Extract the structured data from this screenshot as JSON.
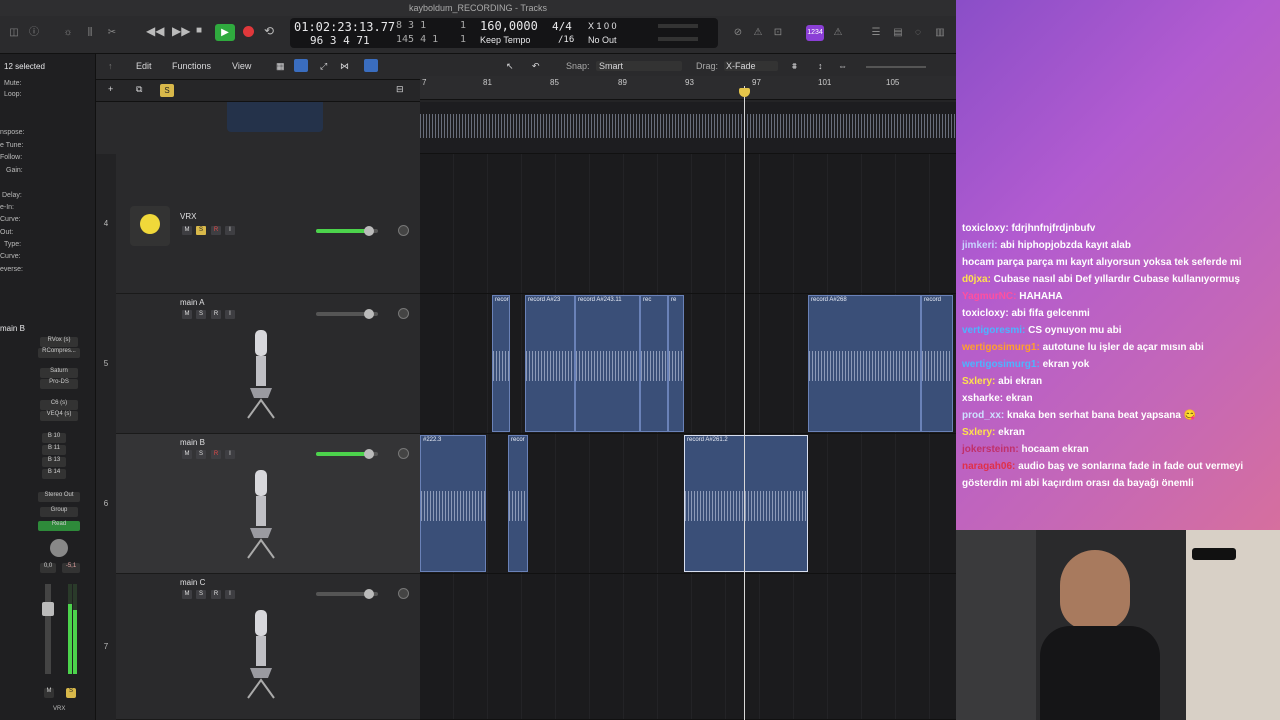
{
  "window": {
    "title": "kayboldum_RECORDING - Tracks"
  },
  "lcd": {
    "time": "01:02:23:13.77",
    "bars": "96 3 4 71",
    "bar_pos_a": "8 3 1",
    "bar_pos_b": "145 4 1",
    "pos_one": "1",
    "tempo": "160,0000",
    "tempo_mode": "Keep Tempo",
    "signature": "4/4",
    "division": "/16",
    "in_label": "X 1 0 0",
    "out_label": "No Out"
  },
  "edit_menu": {
    "edit": "Edit",
    "functions": "Functions",
    "view": "View",
    "snap_label": "Snap:",
    "snap_value": "Smart",
    "drag_label": "Drag:",
    "drag_value": "X-Fade"
  },
  "inspector": {
    "selected": "12 selected",
    "rows": [
      "Mute:",
      "Loop:",
      "nspose:",
      "e Tune:",
      "Follow:",
      "Gain:",
      "Delay:",
      "e-In:",
      "Curve:",
      "Out:",
      "Type:",
      "Curve:",
      "everse:"
    ],
    "strip_name": "main B",
    "plugins": [
      "RVox (s)",
      "RCompres...",
      "Saturn",
      "Pro-DS",
      "C6 (s)",
      "VEQ4 (s)"
    ],
    "sends": [
      "B 10",
      "B 11",
      "B 13",
      "B 14"
    ],
    "output": "Stereo Out",
    "group": "Group",
    "automation": "Read",
    "vol_a": "0,0",
    "vol_b": "-5,1",
    "ms_m": "M",
    "ms_s": "S",
    "bottom_label": "VRX"
  },
  "ruler": [
    "7",
    "81",
    "85",
    "89",
    "93",
    "97",
    "101",
    "105"
  ],
  "tracks": [
    {
      "num": "4",
      "name": "VRX"
    },
    {
      "num": "5",
      "name": "main A"
    },
    {
      "num": "6",
      "name": "main B"
    },
    {
      "num": "7",
      "name": "main C"
    }
  ],
  "msri": {
    "m": "M",
    "s": "S",
    "r": "R",
    "i": "I"
  },
  "regions": {
    "main_a": [
      "record",
      "record A#23",
      "record A#243.11",
      "rec",
      "re",
      "record A#268",
      "record"
    ],
    "main_b": [
      "#222.3",
      "recor",
      "record A#261.2"
    ]
  },
  "chat": [
    {
      "user": "toxicloxy:",
      "text": "fdrjhnfnjfrdjnbufv",
      "color": "#ffffff"
    },
    {
      "user": "jimkeri:",
      "text": "abi hiphopjobzda kayıt alab",
      "color": "#c9d4ff"
    },
    {
      "user": "",
      "text": "hocam parça parça mı kayıt alıyorsun yoksa tek seferde mi",
      "color": "#c0306a"
    },
    {
      "user": "d0jxa:",
      "text": "Cubase nasıl abi Def yıllardır Cubase kullanıyormuş",
      "color": "#ffe14d"
    },
    {
      "user": "YagmurNC:",
      "text": "HAHAHA",
      "color": "#ff4fa0"
    },
    {
      "user": "toxicloxy:",
      "text": "abi fifa gelcenmi",
      "color": "#ffffff"
    },
    {
      "user": "vertigoresmi:",
      "text": "CS oynuyon mu abi",
      "color": "#4db4ff"
    },
    {
      "user": "wertigosimurg1:",
      "text": "autotune lu işler de açar mısın abi",
      "color": "#ff9f2d"
    },
    {
      "user": "wertigosimurg1:",
      "text": "ekran yok",
      "color": "#4db4ff"
    },
    {
      "user": "Sxlery:",
      "text": "abi ekran",
      "color": "#ffe14d"
    },
    {
      "user": "xsharke:",
      "text": "ekran",
      "color": "#ffffff"
    },
    {
      "user": "prod_xx:",
      "text": "knaka ben serhat bana beat yapsana 😋",
      "color": "#cfe0ff"
    },
    {
      "user": "Sxlery:",
      "text": "ekran",
      "color": "#ffe14d"
    },
    {
      "user": "jokersteinn:",
      "text": "hocaam ekran",
      "color": "#c0306a"
    },
    {
      "user": "naragah06:",
      "text": "audio baş ve sonlarına fade in fade out vermeyi gösterdin mi abi kaçırdım orası da bayağı önemli",
      "color": "#e0304a"
    }
  ],
  "colors": {
    "play": "#2faa3e",
    "record": "#e0383b",
    "region": "#3a4f78",
    "meter": "#4cd34c"
  }
}
